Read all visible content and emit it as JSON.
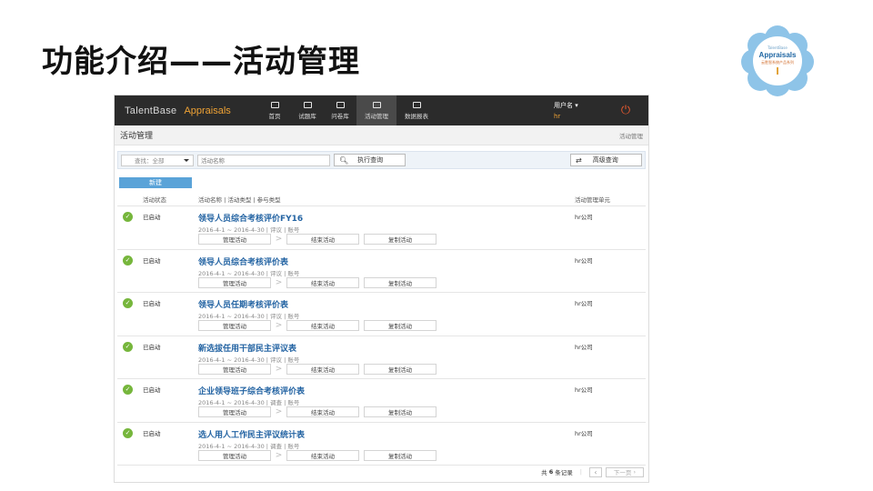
{
  "slide": {
    "title": "功能介绍——活动管理"
  },
  "logo": {
    "small_text": "TalentBase",
    "brand": "Appraisals",
    "sub_text": "云胜智系统产品系列"
  },
  "app": {
    "brand_name": "TalentBase",
    "brand_app": "Appraisals",
    "nav": [
      {
        "label": "首页",
        "icon": "building-icon",
        "active": false
      },
      {
        "label": "试题库",
        "icon": "card-icon",
        "active": false
      },
      {
        "label": "问卷库",
        "icon": "user-icon",
        "active": false
      },
      {
        "label": "活动管理",
        "icon": "checkbox-icon",
        "active": true
      },
      {
        "label": "数据报表",
        "icon": "cube-icon",
        "active": false
      }
    ],
    "user": {
      "name": "用户名 ▾",
      "org": "hr"
    },
    "power_icon": "power-icon",
    "page_title": "活动管理",
    "breadcrumb": "活动管理",
    "search": {
      "select_value": "查找：全部",
      "name_placeholder": "活动名称",
      "query_label": "执行查询",
      "advanced_label": "高级查询"
    },
    "new_button": "新建",
    "headers": {
      "status": "活动状态",
      "name": "活动名称 | 活动类型 | 参与类型",
      "unit": "活动管理单元"
    },
    "rows": [
      {
        "status": "已启动",
        "name": "领导人员综合考核评价FY16",
        "meta": "2016-4-1 ~ 2016-4-30  |  评议  |  账号",
        "unit": "hr公司"
      },
      {
        "status": "已启动",
        "name": "领导人员综合考核评价表",
        "meta": "2016-4-1 ~ 2016-4-30  |  评议  |  账号",
        "unit": "hr公司"
      },
      {
        "status": "已启动",
        "name": "领导人员任期考核评价表",
        "meta": "2016-4-1 ~ 2016-4-30  |  评议  |  账号",
        "unit": "hr公司"
      },
      {
        "status": "已启动",
        "name": "新选拔任用干部民主评议表",
        "meta": "2016-4-1 ~ 2016-4-30  |  评议  |  账号",
        "unit": "hr公司"
      },
      {
        "status": "已启动",
        "name": "企业领导班子综合考核评价表",
        "meta": "2016-4-1 ~ 2016-4-30  |  调查  |  账号",
        "unit": "hr公司"
      },
      {
        "status": "已启动",
        "name": "选人用人工作民主评议统计表",
        "meta": "2016-4-1 ~ 2016-4-30  |  调查  |  账号",
        "unit": "hr公司"
      }
    ],
    "row_actions": {
      "manage": "管理活动",
      "end": "结束活动",
      "copy": "复制活动"
    },
    "pager": {
      "total_prefix": "共",
      "total_count": "6",
      "total_suffix": "条记录",
      "next": "下一页"
    }
  }
}
